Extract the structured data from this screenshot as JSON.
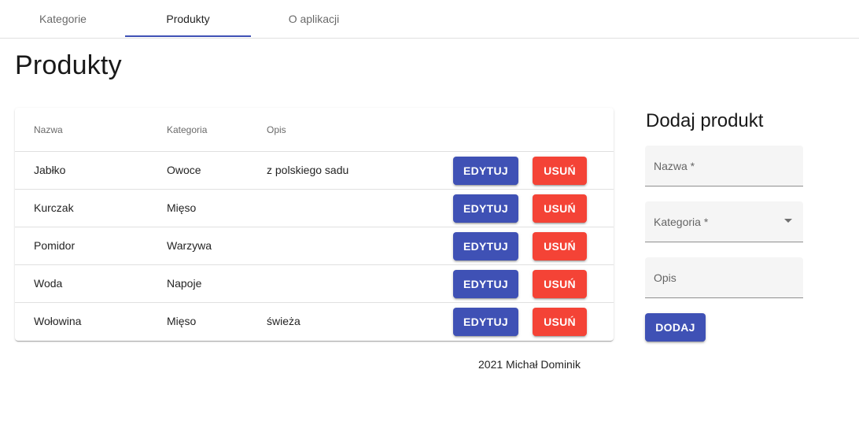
{
  "tabs": [
    {
      "label": "Kategorie",
      "active": false
    },
    {
      "label": "Produkty",
      "active": true
    },
    {
      "label": "O aplikacji",
      "active": false
    }
  ],
  "page": {
    "title": "Produkty"
  },
  "table": {
    "headers": {
      "name": "Nazwa",
      "category": "Kategoria",
      "description": "Opis"
    },
    "rows": [
      {
        "name": "Jabłko",
        "category": "Owoce",
        "description": "z polskiego sadu"
      },
      {
        "name": "Kurczak",
        "category": "Mięso",
        "description": ""
      },
      {
        "name": "Pomidor",
        "category": "Warzywa",
        "description": ""
      },
      {
        "name": "Woda",
        "category": "Napoje",
        "description": ""
      },
      {
        "name": "Wołowina",
        "category": "Mięso",
        "description": "świeża"
      }
    ],
    "edit_label": "EDYTUJ",
    "delete_label": "USUŃ"
  },
  "footer": {
    "text": "2021 Michał Dominik"
  },
  "form": {
    "title": "Dodaj produkt",
    "name_label": "Nazwa *",
    "category_label": "Kategoria *",
    "description_label": "Opis",
    "submit_label": "DODAJ"
  },
  "colors": {
    "primary": "#3f51b5",
    "danger": "#f44336"
  }
}
